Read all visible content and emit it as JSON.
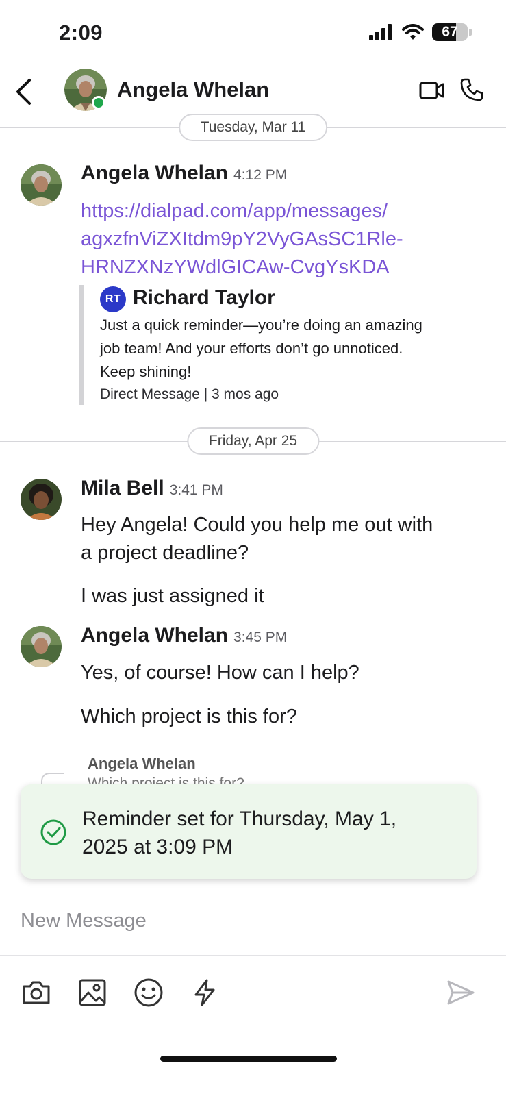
{
  "status_bar": {
    "time": "2:09",
    "battery": "67",
    "battery_level": 0.67
  },
  "header": {
    "contact_name": "Angela Whelan",
    "presence": "online"
  },
  "conversation": {
    "dates": [
      "Tuesday, Mar 11",
      "Friday, Apr 25"
    ],
    "messages": [
      {
        "sender": "Angela Whelan",
        "time": "4:12 PM",
        "lines": [
          "https://dialpad.com/app/messages/",
          "agxzfnViZXItdm9pY2VyGAsSC1Rle-",
          "HRNZXNzYWdlGICAw-CvgYsKDA"
        ],
        "quote": {
          "initials": "RT",
          "author": "Richard Taylor",
          "lines": [
            "Just a quick reminder—you’re doing an amazing",
            "job team! And your efforts don’t go unnoticed.",
            "Keep shining!"
          ],
          "meta": "Direct Message | 3 mos ago"
        }
      },
      {
        "sender": "Mila Bell",
        "time": "3:41 PM",
        "text": [
          "Hey Angela! Could you help me out with",
          "a project deadline?"
        ],
        "text2": "I was just assigned it"
      },
      {
        "sender": "Angela Whelan",
        "time": "3:45 PM",
        "text": "Yes, of course! How can I help?",
        "text2": "Which project is this for?"
      }
    ],
    "reply_preview": {
      "name": "Angela Whelan",
      "text": "Which project is this for?"
    }
  },
  "toast": {
    "lines": [
      "Reminder set for Thursday, May 1,",
      "2025 at 3:09 PM"
    ]
  },
  "composer": {
    "placeholder": "New Message"
  },
  "toolbar": {
    "icons": [
      "camera-icon",
      "image-icon",
      "emoji-icon",
      "lightning-icon",
      "send-icon"
    ]
  },
  "colors": {
    "link": "#7a55d6",
    "presence": "#1fa74b",
    "toast_bg": "#edf7ec",
    "quote_avatar": "#2b39c8"
  }
}
